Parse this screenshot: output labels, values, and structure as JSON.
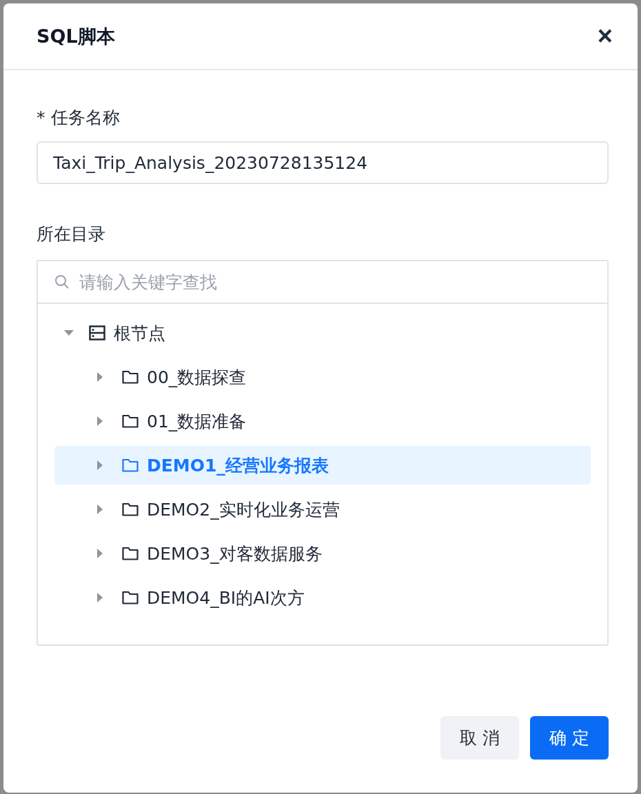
{
  "dialog": {
    "title": "SQL脚本",
    "close": "×"
  },
  "task_name": {
    "label": "任务名称",
    "required_mark": "*",
    "value": "Taxi_Trip_Analysis_20230728135124"
  },
  "directory": {
    "label": "所在目录",
    "search": {
      "placeholder": "请输入关键字查找"
    },
    "tree": [
      {
        "label": "根节点",
        "kind": "root",
        "expanded": true,
        "selected": false,
        "children": [
          {
            "label": "00_数据探查",
            "kind": "folder",
            "expanded": false,
            "selected": false
          },
          {
            "label": "01_数据准备",
            "kind": "folder",
            "expanded": false,
            "selected": false
          },
          {
            "label": "DEMO1_经营业务报表",
            "kind": "folder",
            "expanded": false,
            "selected": true
          },
          {
            "label": "DEMO2_实时化业务运营",
            "kind": "folder",
            "expanded": false,
            "selected": false
          },
          {
            "label": "DEMO3_对客数据服务",
            "kind": "folder",
            "expanded": false,
            "selected": false
          },
          {
            "label": "DEMO4_BI的AI次方",
            "kind": "folder",
            "expanded": false,
            "selected": false
          }
        ]
      }
    ]
  },
  "buttons": [
    {
      "label": "取 消",
      "kind": "secondary"
    },
    {
      "label": "确 定",
      "kind": "primary"
    }
  ]
}
